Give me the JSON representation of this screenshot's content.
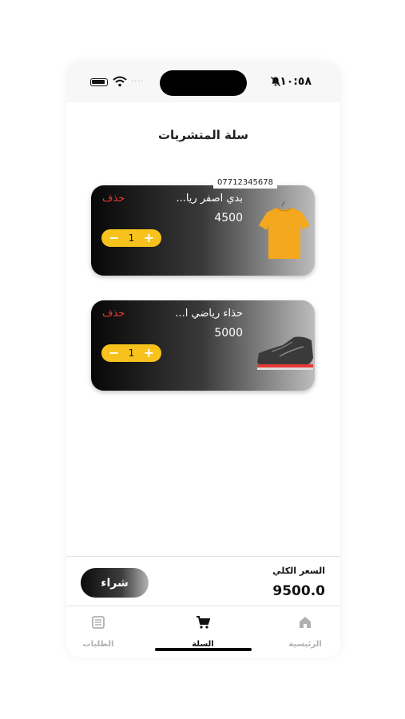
{
  "status": {
    "time": "١٠:٥٨",
    "signal_dots": "····"
  },
  "page": {
    "title": "سلة المتشريات"
  },
  "cart_items": [
    {
      "name": "بدي اصفر ريا...",
      "price": "4500",
      "qty": "1",
      "delete_label": "حذف",
      "minus": "−",
      "plus": "+",
      "phone_tag": "07712345678"
    },
    {
      "name": "حذاء رياضي ا...",
      "price": "5000",
      "qty": "1",
      "delete_label": "حذف",
      "minus": "−",
      "plus": "+"
    }
  ],
  "footer": {
    "total_label": "السعر الكلي",
    "total_value": "9500.0",
    "buy_label": "شراء"
  },
  "tabs": [
    {
      "label": "الرئيسية",
      "icon": "home-icon"
    },
    {
      "label": "السلة",
      "icon": "cart-icon",
      "active": true
    },
    {
      "label": "الطلبات",
      "icon": "orders-icon"
    }
  ],
  "colors": {
    "accent": "#f7c21b",
    "delete": "#e53935"
  }
}
